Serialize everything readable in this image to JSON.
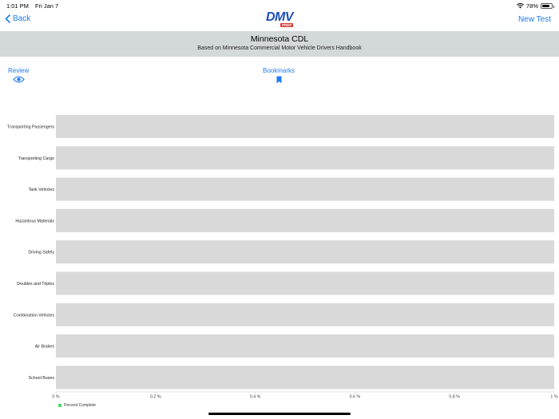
{
  "status_bar": {
    "time": "1:01 PM",
    "date": "Fri Jan 7",
    "battery": "78%",
    "battery_level": 0.78
  },
  "nav": {
    "back_label": "Back",
    "new_test_label": "New Test",
    "logo_text": "DMV",
    "logo_sub": "PREP"
  },
  "header": {
    "title": "Minnesota CDL",
    "subtitle": "Based on Minnesota Commercial Motor Vehicle Drivers Handbook"
  },
  "tabs": {
    "review_label": "Review",
    "bookmarks_label": "Bookmarks"
  },
  "colors": {
    "accent": "#1e7cf2",
    "header_band": "#d3d8db",
    "bar_track": "#d9d9d9",
    "series": "#4cd964"
  },
  "chart_data": {
    "type": "bar",
    "orientation": "horizontal",
    "categories": [
      "Transporting Passengers",
      "Transporting Cargo",
      "Tank Vehicles",
      "Hazardous Materials",
      "Driving Safely",
      "Doubles and Triples",
      "Combination Vehicles",
      "Air Brakes",
      "School Buses"
    ],
    "series": [
      {
        "name": "Percent Complete",
        "values": [
          0,
          0,
          0,
          0,
          0,
          0,
          0,
          0,
          0
        ]
      }
    ],
    "xlim": [
      0,
      1
    ],
    "xticks": [
      "0 %",
      "0.2 %",
      "0.4 %",
      "0.6 %",
      "0.8 %",
      "1 %"
    ],
    "legend": "bottom-left"
  }
}
